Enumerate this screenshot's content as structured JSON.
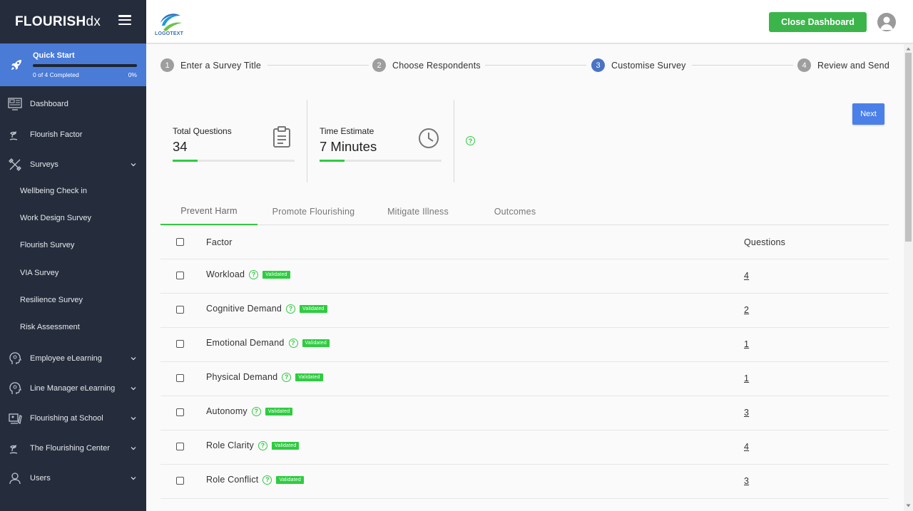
{
  "sidebar": {
    "brand_bold": "FLOURISH",
    "brand_light": "dx",
    "quick_start": {
      "title": "Quick Start",
      "progress_text": "0 of 4 Completed",
      "percent": "0%",
      "progress": 0
    },
    "items": [
      {
        "label": "Dashboard",
        "icon": "dashboard-icon"
      },
      {
        "label": "Flourish Factor",
        "icon": "plant-icon"
      },
      {
        "label": "Surveys",
        "icon": "tools-icon"
      },
      {
        "label": "Employee eLearning",
        "icon": "head-icon"
      },
      {
        "label": "Line Manager eLearning",
        "icon": "head-icon"
      },
      {
        "label": "Flourishing at School",
        "icon": "school-icon"
      },
      {
        "label": "The Flourishing Center",
        "icon": "plant-icon"
      },
      {
        "label": "Users",
        "icon": "users-icon"
      }
    ],
    "survey_subitems": [
      "Wellbeing Check in",
      "Work Design Survey",
      "Flourish Survey",
      "VIA Survey",
      "Resilience Survey",
      "Risk Assessment"
    ]
  },
  "topbar": {
    "logo_text": "LOGOTEXT",
    "close_button": "Close Dashboard"
  },
  "stepper": {
    "steps": [
      {
        "num": "1",
        "label": "Enter a Survey Title"
      },
      {
        "num": "2",
        "label": "Choose Respondents"
      },
      {
        "num": "3",
        "label": "Customise Survey"
      },
      {
        "num": "4",
        "label": "Review and Send"
      }
    ],
    "active": 3
  },
  "stats": {
    "total_questions_label": "Total Questions",
    "total_questions_value": "34",
    "time_estimate_label": "Time Estimate",
    "time_estimate_value": "7 Minutes",
    "help": "?"
  },
  "next_button": "Next",
  "tabs": [
    "Prevent Harm",
    "Promote Flourishing",
    "Mitigate Illness",
    "Outcomes"
  ],
  "table": {
    "header_factor": "Factor",
    "header_questions": "Questions",
    "badge": "Validated",
    "rows": [
      {
        "factor": "Workload",
        "questions": "4"
      },
      {
        "factor": "Cognitive Demand",
        "questions": "2"
      },
      {
        "factor": "Emotional Demand",
        "questions": "1"
      },
      {
        "factor": "Physical Demand",
        "questions": "1"
      },
      {
        "factor": "Autonomy",
        "questions": "3"
      },
      {
        "factor": "Role Clarity",
        "questions": "4"
      },
      {
        "factor": "Role Conflict",
        "questions": "3"
      }
    ]
  },
  "colors": {
    "sidebar_bg": "#252d3d",
    "quick_start_bg": "#4a7bd6",
    "accent_green": "#2ecc40",
    "close_button": "#3bb54a",
    "next_button": "#4a80e8",
    "active_step": "#4a73c4"
  }
}
